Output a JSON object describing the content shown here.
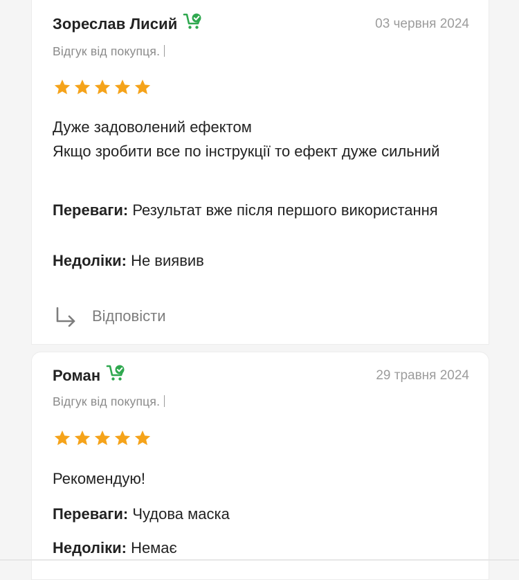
{
  "colors": {
    "star": "#f5a31a",
    "buyer_badge": "#2fa84f",
    "date": "#9c9c9c",
    "muted_text": "#8a8a8a"
  },
  "reviews": [
    {
      "author": "Зореслав Лисий",
      "badge_icon": "buyer-cart-check-icon",
      "date": "03 червня 2024",
      "buyer_note": "Відгук від покупця.",
      "rating": 5,
      "comment_lines": [
        "Дуже задоволений ефектом",
        "Якщо зробити все по інструкції то ефект дуже сильний"
      ],
      "pros_label": "Переваги:",
      "pros": "Результат вже після першого використання",
      "cons_label": "Недоліки:",
      "cons": "Не виявив",
      "reply_label": "Відповісти"
    },
    {
      "author": "Роман",
      "badge_icon": "buyer-cart-check-icon",
      "date": "29 травня 2024",
      "buyer_note": "Відгук від покупця.",
      "rating": 5,
      "comment_lines": [
        "Рекомендую!"
      ],
      "pros_label": "Переваги:",
      "pros": "Чудова маска",
      "cons_label": "Недоліки:",
      "cons": "Немає"
    }
  ]
}
